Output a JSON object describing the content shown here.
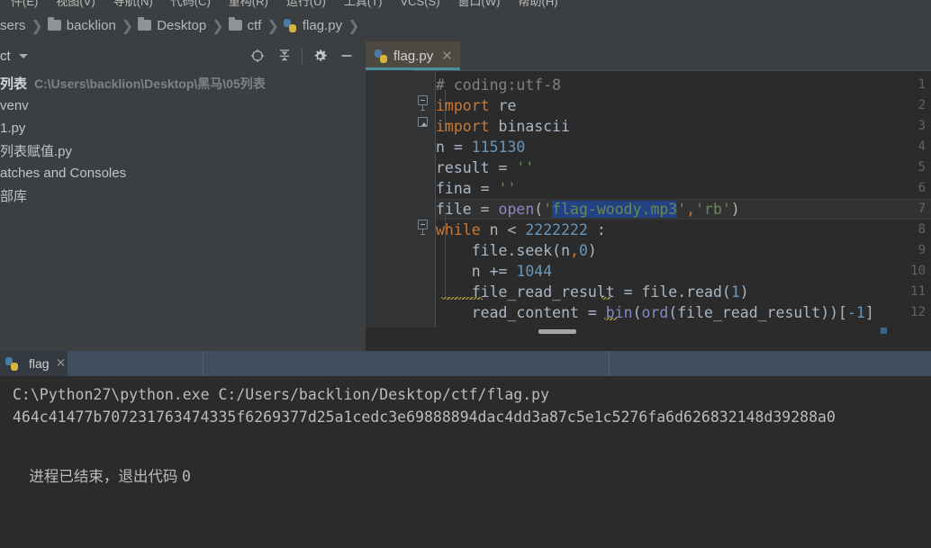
{
  "menubar": {
    "items": [
      "件(E)",
      "视图(V)",
      "导航(N)",
      "代码(C)",
      "重构(R)",
      "运行(U)",
      "工具(T)",
      "VCS(S)",
      "窗口(W)",
      "帮助(H)"
    ]
  },
  "breadcrumb": {
    "items": [
      {
        "label": "sers",
        "icon": "none"
      },
      {
        "label": "backlion",
        "icon": "folder-icon"
      },
      {
        "label": "Desktop",
        "icon": "folder-icon"
      },
      {
        "label": "ctf",
        "icon": "folder-icon"
      },
      {
        "label": "flag.py",
        "icon": "python-file-icon"
      }
    ],
    "separator": "❯"
  },
  "tool_window": {
    "title": "ct",
    "actions": [
      {
        "name": "locate-icon",
        "tooltip": "Select Opened File"
      },
      {
        "name": "collapse-all-icon",
        "tooltip": "Collapse All"
      },
      {
        "name": "gear-icon",
        "tooltip": "Settings"
      },
      {
        "name": "minimize-icon",
        "tooltip": "Hide"
      }
    ]
  },
  "sidebar": {
    "items": [
      {
        "label": "列表",
        "location": "C:\\Users\\backlion\\Desktop\\黑马\\05列表",
        "bold": true
      },
      {
        "label": "venv",
        "location": "",
        "bold": false
      },
      {
        "label": "1.py",
        "location": "",
        "bold": false
      },
      {
        "label": "列表赋值.py",
        "location": "",
        "bold": false
      },
      {
        "label": "atches and Consoles",
        "location": "",
        "bold": false
      },
      {
        "label": "部库",
        "location": "",
        "bold": false
      }
    ]
  },
  "editor": {
    "tab": {
      "label": "flag.py",
      "icon": "python-file-icon",
      "close": "✕"
    },
    "lines": [
      {
        "n": "1",
        "html": "<span class='cmt'># coding:utf-8</span>"
      },
      {
        "n": "2",
        "html": "<span class='kw'>import</span> re"
      },
      {
        "n": "3",
        "html": "<span class='kw'>import</span> binascii"
      },
      {
        "n": "4",
        "html": "n = <span class='num'>115130</span>"
      },
      {
        "n": "5",
        "html": "result = <span class='str'>''</span>"
      },
      {
        "n": "6",
        "html": "fina = <span class='str'>''</span>"
      },
      {
        "n": "7",
        "html": "file = <span class='fn'>open</span>(<span class='str'>'</span><span class='str sel'>flag-woody.mp3</span><span class='str'>'</span><span class='err-comma'>,</span><span class='str'>'rb'</span>)"
      },
      {
        "n": "8",
        "html": "<span class='kw'>while</span> n &lt; <span class='num'>2222222</span> :"
      },
      {
        "n": "9",
        "html": "    file.seek(n<span class='err-comma'>,</span><span class='num'>0</span>)"
      },
      {
        "n": "10",
        "html": "    n += <span class='num'>1044</span>"
      },
      {
        "n": "11",
        "html": "    file_read_result = file.read(<span class='num'>1</span>)"
      },
      {
        "n": "12",
        "html": "    read_content = <span class='fn'>bin</span>(<span class='fn'>ord</span>(file_read_result))[<span class='num'>-1</span>]"
      }
    ],
    "plain_lines": [
      "# coding:utf-8",
      "import re",
      "import binascii",
      "n = 115130",
      "result = ''",
      "fina = ''",
      "file = open('flag-woody.mp3','rb')",
      "while n < 2222222 :",
      "    file.seek(n,0)",
      "    n += 1044",
      "    file_read_result = file.read(1)",
      "    read_content = bin(ord(file_read_result))[-1]"
    ],
    "selection": "flag-woody.mp3",
    "caret_line": 7
  },
  "run_window": {
    "tab": {
      "label": "flag",
      "icon": "python-file-icon",
      "close": "✕"
    },
    "output": [
      "C:\\Python27\\python.exe C:/Users/backlion/Desktop/ctf/flag.py",
      "464c41477b707231763474335f6269377d25a1cedc3e69888894dac4dd3a87c5e1c5276fa6d626832148d39288a0"
    ],
    "status": "进程已结束，退出代码 ",
    "exit_code": "0"
  },
  "colors": {
    "chrome": "#3c3f41",
    "editor_bg": "#2b2b2b",
    "gutter": "#313335",
    "selection": "#214283",
    "tab_active": "#4e4a41",
    "tab_underline": "#4a8f9b",
    "keyword": "#cc7832",
    "number": "#6897bb",
    "string": "#6a8759",
    "function": "#8888c6",
    "comment": "#808080",
    "run_tabbar": "#3f4e5e"
  }
}
